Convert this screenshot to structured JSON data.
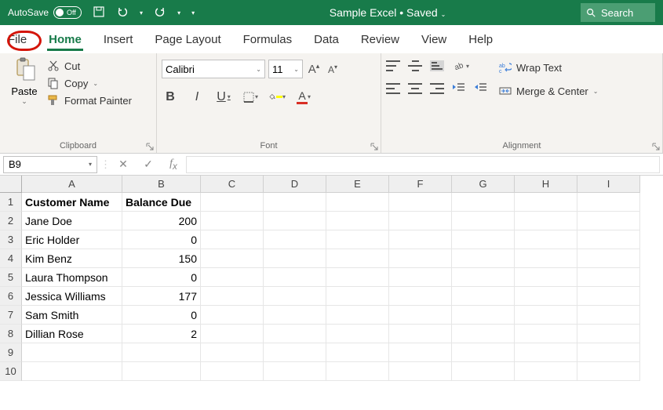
{
  "titlebar": {
    "autosave_label": "AutoSave",
    "autosave_state": "Off",
    "title": "Sample Excel • Saved",
    "search_placeholder": "Search"
  },
  "tabs": {
    "file": "File",
    "home": "Home",
    "insert": "Insert",
    "page_layout": "Page Layout",
    "formulas": "Formulas",
    "data": "Data",
    "review": "Review",
    "view": "View",
    "help": "Help"
  },
  "ribbon": {
    "clipboard": {
      "paste": "Paste",
      "cut": "Cut",
      "copy": "Copy",
      "format_painter": "Format Painter",
      "group_label": "Clipboard"
    },
    "font": {
      "font_name": "Calibri",
      "font_size": "11",
      "group_label": "Font"
    },
    "alignment": {
      "wrap_text": "Wrap Text",
      "merge_center": "Merge & Center",
      "group_label": "Alignment"
    }
  },
  "formula_bar": {
    "name_box": "B9"
  },
  "columns": [
    "A",
    "B",
    "C",
    "D",
    "E",
    "F",
    "G",
    "H",
    "I"
  ],
  "rows": [
    {
      "n": 1,
      "a": "Customer Name",
      "b": "Balance Due",
      "hdr": true
    },
    {
      "n": 2,
      "a": "Jane Doe",
      "b": "200"
    },
    {
      "n": 3,
      "a": "Eric Holder",
      "b": "0"
    },
    {
      "n": 4,
      "a": "Kim Benz",
      "b": "150"
    },
    {
      "n": 5,
      "a": "Laura Thompson",
      "b": "0"
    },
    {
      "n": 6,
      "a": "Jessica Williams",
      "b": "177"
    },
    {
      "n": 7,
      "a": "Sam Smith",
      "b": "0"
    },
    {
      "n": 8,
      "a": "Dillian Rose",
      "b": "2"
    },
    {
      "n": 9,
      "a": "",
      "b": ""
    },
    {
      "n": 10,
      "a": "",
      "b": ""
    }
  ]
}
